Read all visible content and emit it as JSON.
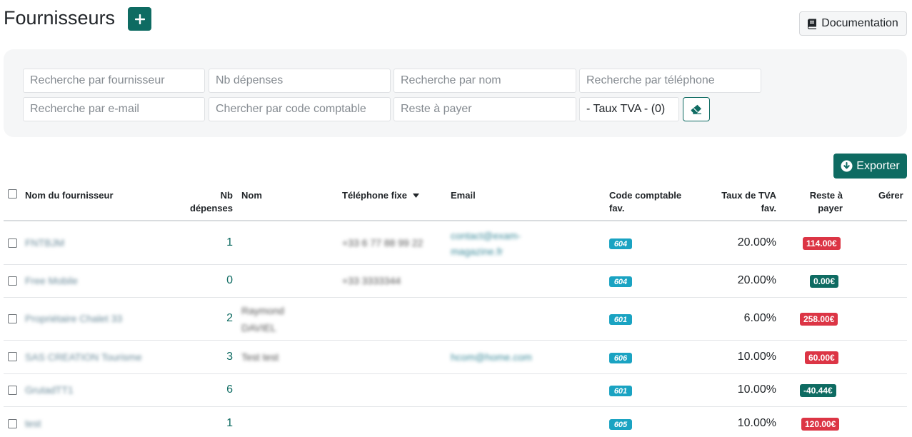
{
  "page": {
    "title": "Fournisseurs",
    "add_icon": "plus-icon",
    "doc_label": "Documentation",
    "doc_icon": "book-icon"
  },
  "filters": {
    "supplier": "Recherche par fournisseur",
    "nb_expenses": "Nb dépenses",
    "name": "Recherche par nom",
    "phone": "Recherche par téléphone",
    "email": "Recherche par e-mail",
    "code": "Chercher par code comptable",
    "remaining": "Reste à payer",
    "tva_select": "- Taux TVA - (0)",
    "clear_icon": "eraser-icon"
  },
  "export": {
    "label": "Exporter",
    "icon": "download-circle-icon"
  },
  "table": {
    "headers": {
      "supplier": "Nom du fournisseur",
      "nb_line1": "Nb",
      "nb_line2": "dépenses",
      "name": "Nom",
      "phone": "Téléphone fixe",
      "email": "Email",
      "code_line1": "Code comptable",
      "code_line2": "fav.",
      "tva_line1": "Taux de TVA",
      "tva_line2": "fav.",
      "rest_line1": "Reste à",
      "rest_line2": "payer",
      "manage": "Gérer"
    },
    "rows": [
      {
        "supplier": "FNTBJM",
        "count": "1",
        "name": "",
        "name2": "",
        "phone": "+33 6 77 88 99 22",
        "email": "contact@exam-",
        "email2": "magazine.fr",
        "code": "604",
        "tva": "20.00%",
        "due": "114.00€",
        "due_status": "negative"
      },
      {
        "supplier": "Free Mobile",
        "count": "0",
        "name": "",
        "name2": "",
        "phone": "+33 3333344",
        "email": "",
        "email2": "",
        "code": "604",
        "tva": "20.00%",
        "due": "0.00€",
        "due_status": "ok"
      },
      {
        "supplier": "Propriétaire Chalet 33",
        "count": "2",
        "name": "Raymond",
        "name2": "DAVIEL",
        "phone": "",
        "email": "",
        "email2": "",
        "code": "601",
        "tva": "6.00%",
        "due": "258.00€",
        "due_status": "negative"
      },
      {
        "supplier": "SAS CREATION Tourisme",
        "count": "3",
        "name": "Test test",
        "name2": "",
        "phone": "",
        "email": "hcom@home.com",
        "email2": "",
        "code": "606",
        "tva": "10.00%",
        "due": "60.00€",
        "due_status": "negative"
      },
      {
        "supplier": "GrutadTT1",
        "count": "6",
        "name": "",
        "name2": "",
        "phone": "",
        "email": "",
        "email2": "",
        "code": "601",
        "tva": "10.00%",
        "due": "-40.44€",
        "due_status": "ok"
      },
      {
        "supplier": "test",
        "count": "1",
        "name": "",
        "name2": "",
        "phone": "",
        "email": "",
        "email2": "",
        "code": "605",
        "tva": "10.00%",
        "due": "120.00€",
        "due_status": "negative"
      }
    ]
  },
  "colors": {
    "primary": "#0e6b62",
    "danger": "#dc3545",
    "info": "#1aa3c2",
    "panel": "#f5f6f7"
  }
}
